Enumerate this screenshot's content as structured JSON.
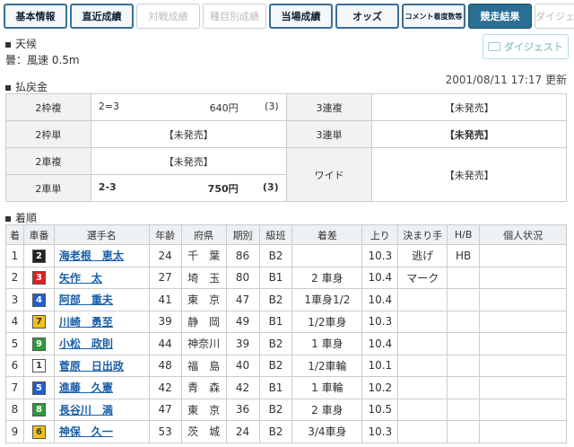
{
  "tabs": [
    {
      "label": "基本情報",
      "state": "normal"
    },
    {
      "label": "直近成績",
      "state": "normal"
    },
    {
      "label": "対戦成績",
      "state": "disabled"
    },
    {
      "label": "種目別成績",
      "state": "disabled"
    },
    {
      "label": "当場成績",
      "state": "normal"
    },
    {
      "label": "オッズ",
      "state": "normal"
    },
    {
      "label": "コメント着度数等",
      "state": "normal"
    },
    {
      "label": "競走結果",
      "state": "active"
    },
    {
      "label": "ダイジェスト",
      "state": "disabled"
    }
  ],
  "weather": {
    "heading": "天候",
    "value": "曇：風速 0.5m"
  },
  "digest_button": "ダイジェスト",
  "updated": "2001/08/11 17:17 更新",
  "payout": {
    "heading": "払戻金",
    "rows": [
      {
        "label": "2枠複",
        "combo": "2=3",
        "amount": "640円",
        "pop": "(3)",
        "label2": "3連複",
        "value2": "【未発売】"
      },
      {
        "label": "2枠単",
        "note": "【未発売】",
        "label2": "3連単",
        "value2": "【未発売】"
      },
      {
        "label": "2車複",
        "note": "【未発売】",
        "label2": "ワイド",
        "value2": "【未発売】"
      },
      {
        "label": "2車単",
        "combo": "2-3",
        "amount": "750円",
        "pop": "(3)"
      }
    ]
  },
  "results": {
    "heading": "着順",
    "headers": [
      "着",
      "車番",
      "選手名",
      "年齢",
      "府県",
      "期別",
      "級班",
      "着差",
      "上り",
      "決まり手",
      "H/B",
      "個人状況"
    ],
    "rows": [
      {
        "rank": "1",
        "car": "2",
        "carColor": "#222222",
        "carText": "#ffffff",
        "name": "海老根　恵太",
        "age": "24",
        "pref": "千　葉",
        "term": "86",
        "class": "B2",
        "margin": "",
        "agari": "10.3",
        "kimarite": "逃げ",
        "hb": "HB",
        "status": ""
      },
      {
        "rank": "2",
        "car": "3",
        "carColor": "#e02020",
        "carText": "#ffffff",
        "name": "矢作　太",
        "age": "27",
        "pref": "埼　玉",
        "term": "80",
        "class": "B1",
        "margin": "2 車身",
        "agari": "10.4",
        "kimarite": "マーク",
        "hb": "",
        "status": ""
      },
      {
        "rank": "3",
        "car": "4",
        "carColor": "#1f5fc8",
        "carText": "#ffffff",
        "name": "阿部　重夫",
        "age": "41",
        "pref": "東　京",
        "term": "47",
        "class": "B2",
        "margin": "1車身1/2",
        "agari": "10.4",
        "kimarite": "",
        "hb": "",
        "status": ""
      },
      {
        "rank": "4",
        "car": "7",
        "carColor": "#f2c21a",
        "carText": "#333333",
        "name": "川崎　勇至",
        "age": "39",
        "pref": "静　岡",
        "term": "49",
        "class": "B1",
        "margin": "1/2車身",
        "agari": "10.3",
        "kimarite": "",
        "hb": "",
        "status": ""
      },
      {
        "rank": "5",
        "car": "9",
        "carColor": "#2f9a3a",
        "carText": "#ffffff",
        "name": "小松　政則",
        "age": "44",
        "pref": "神奈川",
        "term": "39",
        "class": "B2",
        "margin": "1 車身",
        "agari": "10.4",
        "kimarite": "",
        "hb": "",
        "status": ""
      },
      {
        "rank": "6",
        "car": "1",
        "carColor": "#ffffff",
        "carText": "#333333",
        "name": "菅原　日出政",
        "age": "48",
        "pref": "福　島",
        "term": "40",
        "class": "B2",
        "margin": "1/2車輪",
        "agari": "10.1",
        "kimarite": "",
        "hb": "",
        "status": ""
      },
      {
        "rank": "7",
        "car": "5",
        "carColor": "#1f5fc8",
        "carText": "#ffffff",
        "name": "進藤　久憲",
        "age": "42",
        "pref": "青　森",
        "term": "42",
        "class": "B1",
        "margin": "1 車輪",
        "agari": "10.2",
        "kimarite": "",
        "hb": "",
        "status": ""
      },
      {
        "rank": "8",
        "car": "8",
        "carColor": "#2f9a3a",
        "carText": "#ffffff",
        "name": "長谷川　満",
        "age": "47",
        "pref": "東　京",
        "term": "36",
        "class": "B2",
        "margin": "2 車身",
        "agari": "10.5",
        "kimarite": "",
        "hb": "",
        "status": ""
      },
      {
        "rank": "9",
        "car": "6",
        "carColor": "#f2c21a",
        "carText": "#333333",
        "name": "神保　久一",
        "age": "53",
        "pref": "茨　城",
        "term": "24",
        "class": "B2",
        "margin": "3/4車身",
        "agari": "10.3",
        "kimarite": "",
        "hb": "",
        "status": ""
      }
    ]
  }
}
